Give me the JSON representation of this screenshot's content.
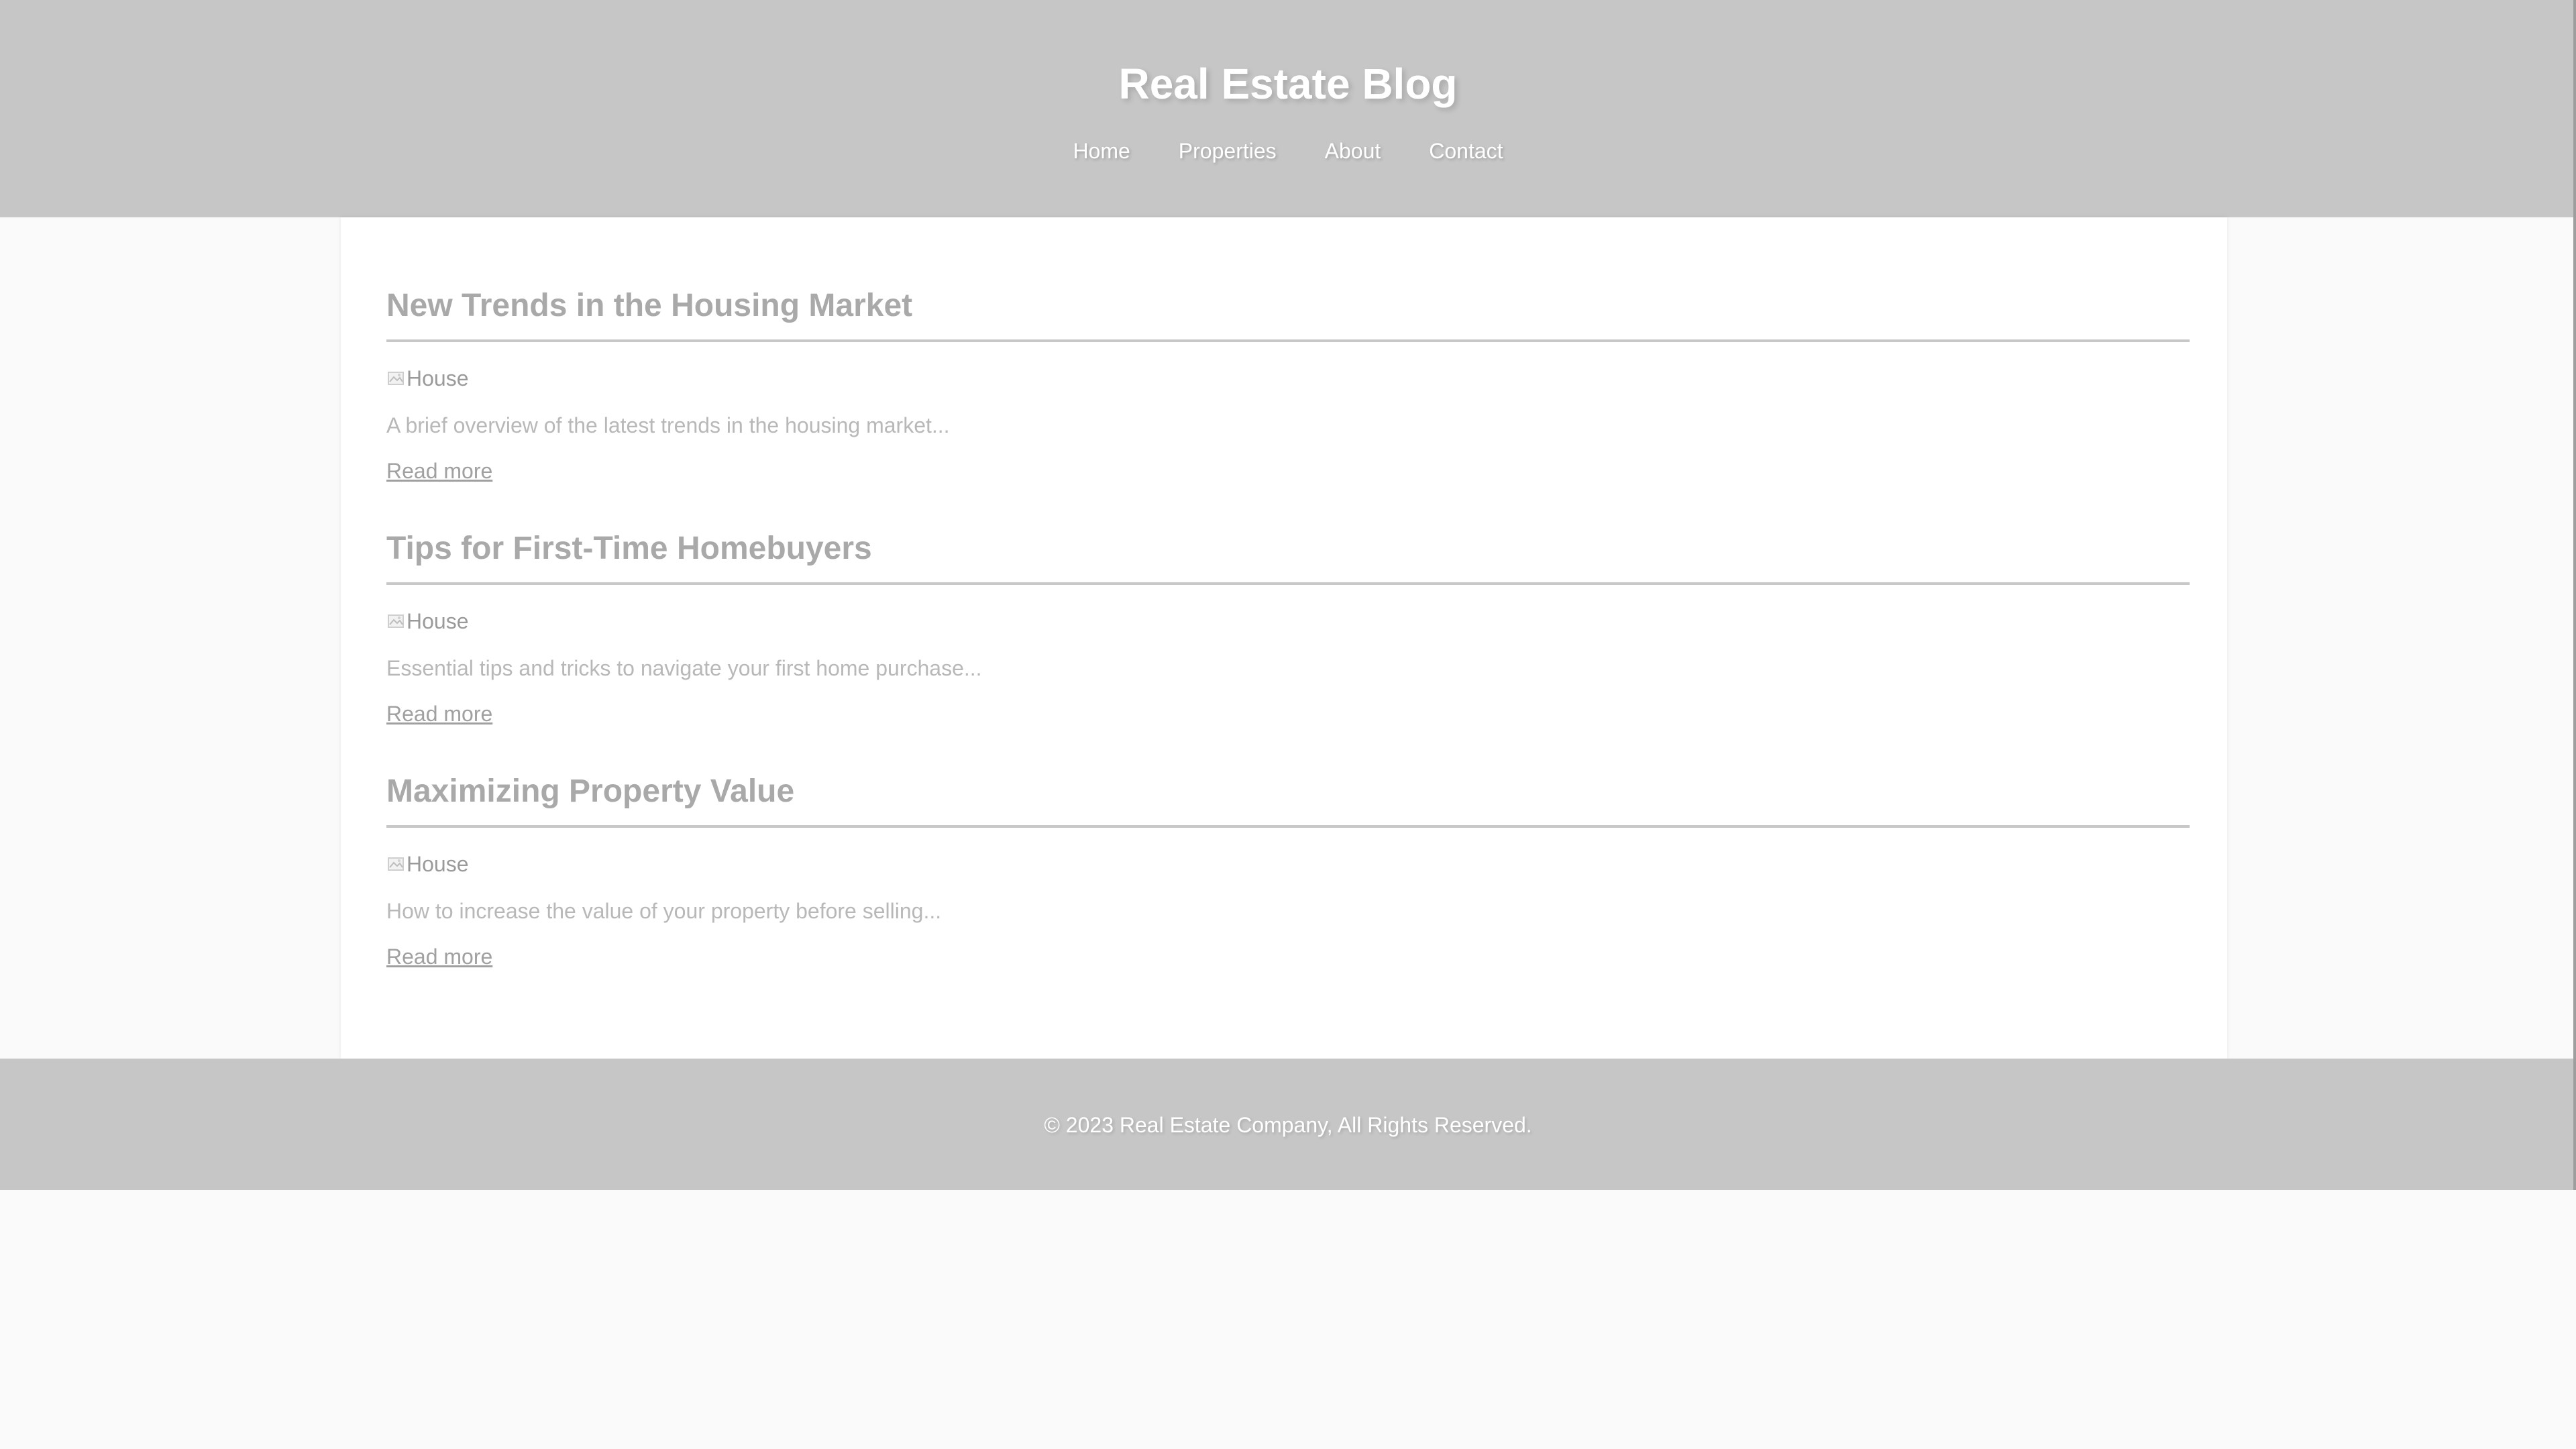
{
  "header": {
    "title": "Real Estate Blog",
    "nav": [
      {
        "label": "Home"
      },
      {
        "label": "Properties"
      },
      {
        "label": "About"
      },
      {
        "label": "Contact"
      }
    ]
  },
  "posts": [
    {
      "title": "New Trends in the Housing Market",
      "image_alt": "House",
      "excerpt": "A brief overview of the latest trends in the housing market...",
      "read_more": "Read more"
    },
    {
      "title": "Tips for First-Time Homebuyers",
      "image_alt": "House",
      "excerpt": "Essential tips and tricks to navigate your first home purchase...",
      "read_more": "Read more"
    },
    {
      "title": "Maximizing Property Value",
      "image_alt": "House",
      "excerpt": "How to increase the value of your property before selling...",
      "read_more": "Read more"
    }
  ],
  "footer": {
    "text": "© 2023 Real Estate Company, All Rights Reserved."
  },
  "colors": {
    "header_bg": "#c6c6c6",
    "page_bg": "#fafafa",
    "title_text": "#a9a9a9"
  }
}
